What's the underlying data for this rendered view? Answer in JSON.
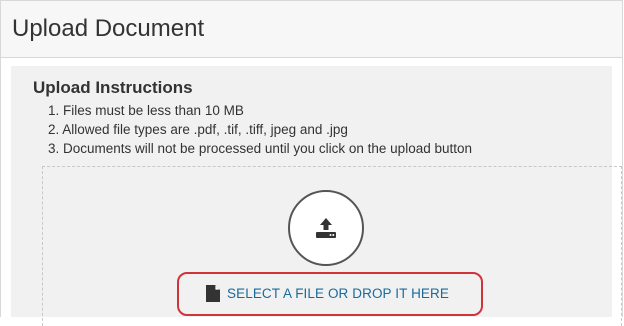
{
  "header": {
    "title": "Upload Document"
  },
  "instructions": {
    "title": "Upload Instructions",
    "items": [
      "1. Files must be less than 10 MB",
      "2. Allowed file types are .pdf, .tif, .tiff, jpeg and .jpg",
      "3. Documents will not be processed until you click on the upload button"
    ]
  },
  "dropzone": {
    "upload_icon": "upload-icon",
    "select_label": "SELECT A FILE OR DROP IT HERE",
    "file_icon": "file-icon",
    "link_color": "#1a6a9a",
    "highlight_color": "#d0343a"
  }
}
